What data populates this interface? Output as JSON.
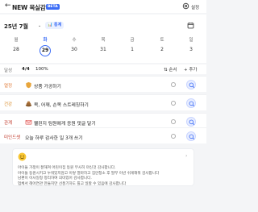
{
  "header": {
    "back_label": "←",
    "title": "NEW 목실감",
    "badge": "BETA",
    "settings_label": "설정"
  },
  "week": {
    "month_label": "25년 7월",
    "month_caret": "⌄",
    "stats_label": "📊 통계",
    "days": [
      {
        "dow": "월",
        "date": "28"
      },
      {
        "dow": "화",
        "date": "29"
      },
      {
        "dow": "수",
        "date": "30"
      },
      {
        "dow": "목",
        "date": "31"
      },
      {
        "dow": "금",
        "date": "1"
      },
      {
        "dow": "토",
        "date": "2"
      },
      {
        "dow": "일",
        "date": "3"
      }
    ],
    "today_index": 1
  },
  "progress": {
    "label": "달성",
    "count": "4/4",
    "percent": "100%",
    "sort_label": "⇅ 순서",
    "add_label": "+ 추가"
  },
  "tasks": [
    {
      "tag": "열정",
      "tag_color": "#e07b39",
      "icon": "shield-icon",
      "text": "상품 가공하기"
    },
    {
      "tag": "건강",
      "tag_color": "#d98b2b",
      "icon": "poop-icon",
      "text": "목, 어깨, 손목 스트레칭하기"
    },
    {
      "tag": "관계",
      "tag_color": "#c0392b",
      "icon": "envelope-icon",
      "text": "웰린지 팀원에게 응원 댓글 달기"
    },
    {
      "tag": "미인드셋",
      "tag_color": "#c0392b",
      "icon": "",
      "text": "오늘 하루 감사한 일 3개 쓰기"
    }
  ],
  "memo": {
    "emoji": "smile-emoji",
    "lines": [
      "아이들 가정이 잘해져 어린이집 등원 무사히 마신것 감사합니다.",
      "아이들 등원시키고 누워있지않고 이렇 열마하고 집안청소 후 딸부 이년 쉬게해줘 감사합니다",
      "남편이 이사일정 정리하여 의미있어 감사합니다.",
      "업체서 헤어연관 만들지만 선풍기하도 틀고 일할 수 있음에 감사합니다"
    ]
  },
  "colors": {
    "accent": "#3b6cf6",
    "ai_icon": "#3b6cf6"
  }
}
